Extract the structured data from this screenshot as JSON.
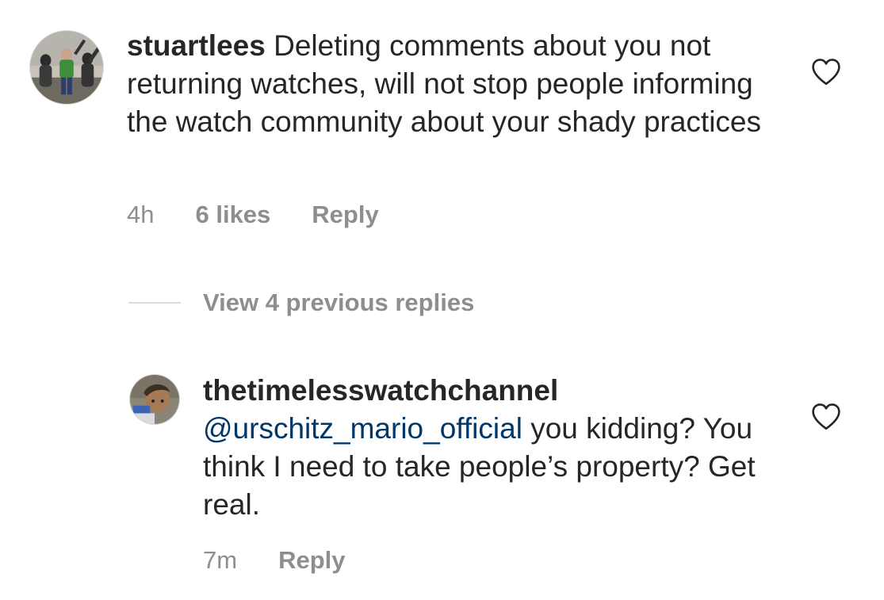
{
  "comments": [
    {
      "username": "stuartlees",
      "text": "Deleting comments about you not returning watches, will not stop people informing the watch community about your shady practices",
      "time": "4h",
      "likes": "6 likes",
      "reply_label": "Reply",
      "avatar_icon": "user-avatar-photo",
      "like_icon": "heart-outline-icon"
    }
  ],
  "view_replies_label": "View 4 previous replies",
  "replies": [
    {
      "username": "thetimelesswatchchannel",
      "mention": "@urschitz_mario_official",
      "text": "you kidding? You think I need to take people’s property? Get real.",
      "time": "7m",
      "reply_label": "Reply",
      "avatar_icon": "user-avatar-photo",
      "like_icon": "heart-outline-icon"
    }
  ],
  "colors": {
    "text": "#262626",
    "secondary": "#8e8e8e",
    "mention": "#00376b",
    "divider": "#dbdbdb"
  }
}
